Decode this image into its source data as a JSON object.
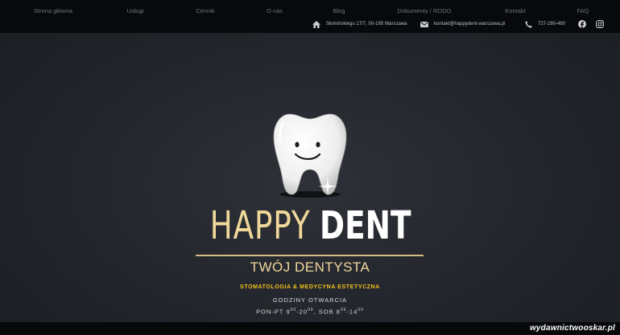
{
  "nav": {
    "items": [
      "Strona główna",
      "Usługi",
      "Cennik",
      "O nas",
      "Blog",
      "Dokumenty / RODO",
      "Kontakt",
      "FAQ"
    ]
  },
  "contact": {
    "address": "Słomińskiego 17/7, 00-195 Warszawa",
    "email": "kontakt@happydent-warszawa.pl",
    "phone": "727-280-480"
  },
  "icons": {
    "address": "home-icon",
    "email": "envelope-icon",
    "phone": "phone-icon",
    "facebook": "facebook-icon",
    "instagram": "instagram-icon"
  },
  "hero": {
    "brand_part1": "HAPPY",
    "brand_part2": "DENT",
    "subtitle": "TWÓJ DENTYSTA",
    "specialty": "STOMATOLOGIA & MEDYCYNA ESTETYCZNA",
    "hours_label": "GODZINY OTWARCIA",
    "hours_weekday_prefix": "PON-PT 9",
    "hours_weekday_open_min": "00",
    "hours_weekday_to": "-20",
    "hours_weekday_close_min": "00",
    "hours_saturday_prefix": ", SOB 8",
    "hours_saturday_open_min": "00",
    "hours_saturday_to": "-14",
    "hours_saturday_close_min": "00"
  },
  "watermark": "wydawnictwooskar.pl",
  "colors": {
    "gold": "#f0d79a",
    "specialty_yellow": "#f4c21c",
    "background": "#25282e",
    "topbar": "#08090b"
  }
}
